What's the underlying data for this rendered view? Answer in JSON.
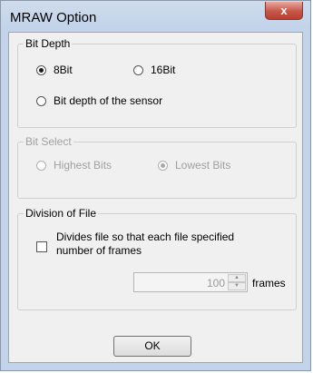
{
  "window": {
    "title": "MRAW Option",
    "close_label": "x"
  },
  "bit_depth": {
    "legend": "Bit Depth",
    "options": [
      "8Bit",
      "16Bit",
      "Bit depth of the sensor"
    ],
    "selected": "8Bit"
  },
  "bit_select": {
    "legend": "Bit Select",
    "options": [
      "Highest Bits",
      "Lowest Bits"
    ],
    "selected": "Lowest Bits"
  },
  "division": {
    "legend": "Division of File",
    "checkbox_label_line1": "Divides file so that each file specified",
    "checkbox_label_line2": "number of frames",
    "frames_value": "100",
    "frames_unit": "frames"
  },
  "ok_label": "OK"
}
